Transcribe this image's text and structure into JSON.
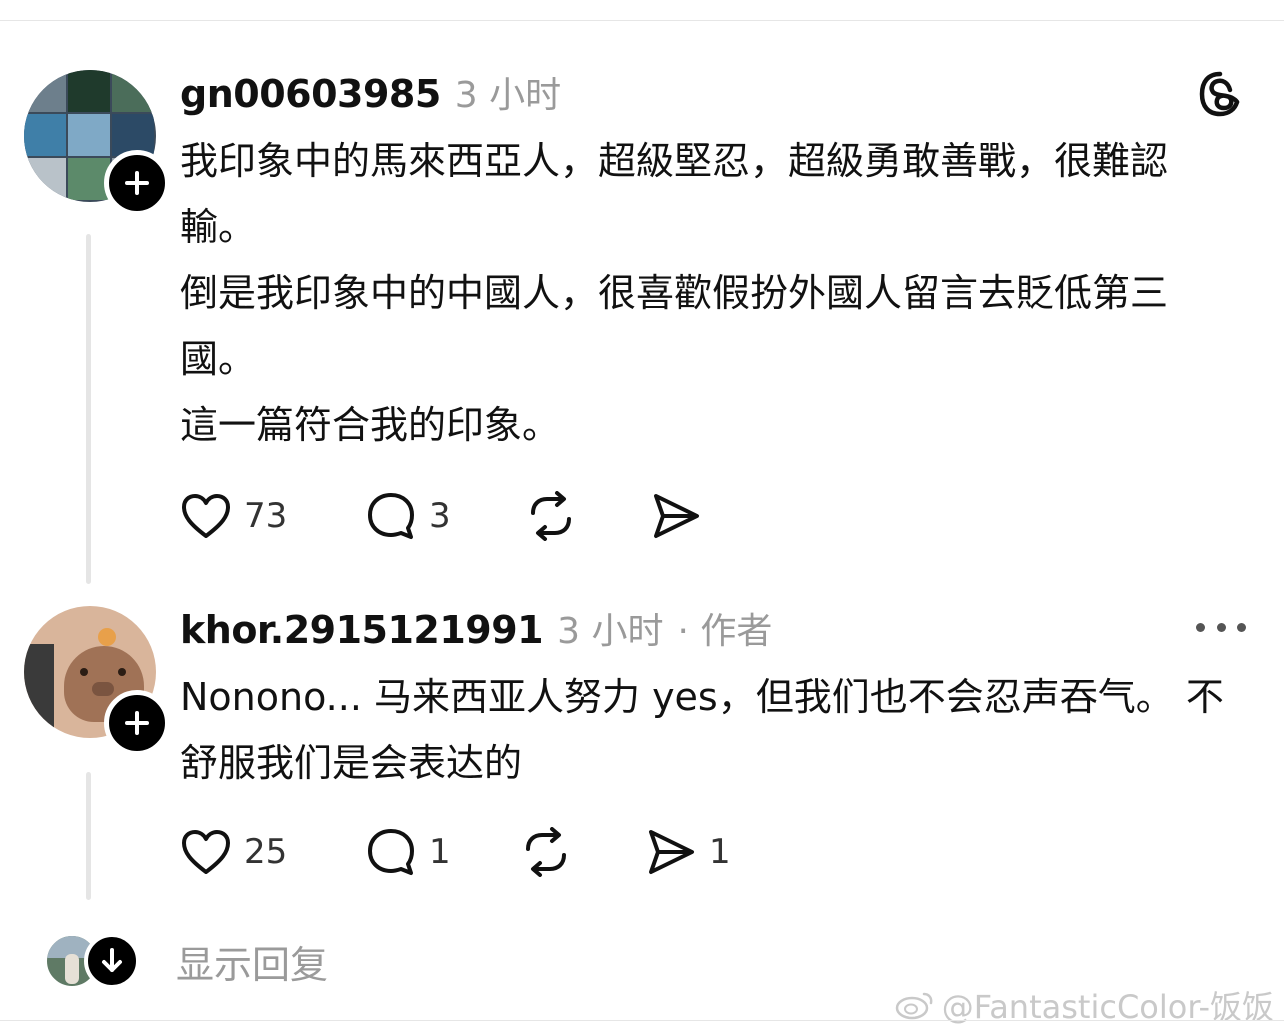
{
  "posts": [
    {
      "username": "gn00603985",
      "time": "3 小时",
      "paragraphs": [
        "我印象中的馬來西亞人，超級堅忍，超級勇敢善戰，很難認輸。",
        "倒是我印象中的中國人，很喜歡假扮外國人留言去貶低第三國。",
        "這一篇符合我的印象。"
      ],
      "likes": "73",
      "comments": "3",
      "shares": ""
    },
    {
      "username": "khor.2915121991",
      "time": "3 小时",
      "author_tag": "· 作者",
      "paragraphs": [
        "Nonono... 马来西亚人努力 yes，但我们也不会忍声吞气。 不舒服我们是会表达的"
      ],
      "likes": "25",
      "comments": "1",
      "shares": "1"
    }
  ],
  "show_replies_label": "显示回复",
  "watermark": "@FantasticColor-饭饭",
  "icons": {
    "threads_logo": "threads-logo-icon",
    "like": "heart-icon",
    "comment": "comment-bubble-icon",
    "repost": "repost-icon",
    "share": "send-icon",
    "more": "more-dots-icon",
    "follow": "plus-icon",
    "expand": "arrow-down-icon"
  },
  "colors": {
    "text": "#111111",
    "meta": "#9a9a9a",
    "thread_line": "#e5e5e5",
    "badge": "#000000"
  }
}
